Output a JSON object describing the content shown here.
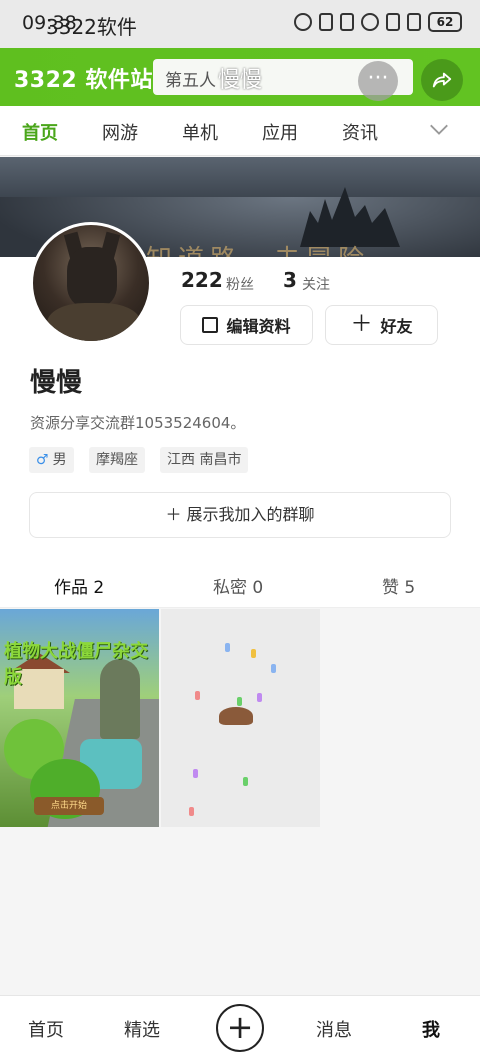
{
  "status_bar": {
    "time": "09:38",
    "app_name": "3322软件",
    "battery": "62"
  },
  "header": {
    "logo": "3322 软件站",
    "search_placeholder": "第五人",
    "page_title": "慢慢",
    "more_label": "···"
  },
  "nav_tabs": [
    {
      "label": "首页",
      "active": true
    },
    {
      "label": "网游",
      "active": false
    },
    {
      "label": "单机",
      "active": false
    },
    {
      "label": "应用",
      "active": false
    },
    {
      "label": "资讯",
      "active": false
    }
  ],
  "banner": {
    "text": "知道路，去冒险"
  },
  "profile": {
    "fans_count": "222",
    "fans_label": "粉丝",
    "follow_count": "3",
    "follow_label": "关注",
    "edit_button": "编辑资料",
    "friend_button": "好友",
    "name": "慢慢",
    "bio": "资源分享交流群1053524604。",
    "tags": [
      {
        "label": "男",
        "icon": "male-icon"
      },
      {
        "label": "摩羯座"
      },
      {
        "label": "江西 南昌市"
      }
    ],
    "groups_button": "＋ 展示我加入的群聊"
  },
  "content_tabs": [
    {
      "label": "作品 2",
      "active": true
    },
    {
      "label": "私密 0",
      "active": false
    },
    {
      "label": "赞 5",
      "active": false
    }
  ],
  "works": [
    {
      "title": "植物大战僵尸杂交版",
      "button": "点击开始"
    },
    {
      "title": ""
    }
  ],
  "bottom_nav": [
    {
      "label": "首页",
      "active": false
    },
    {
      "label": "精选",
      "active": false
    },
    {
      "label": "+",
      "active": false
    },
    {
      "label": "消息",
      "active": false
    },
    {
      "label": "我",
      "active": true
    }
  ],
  "colors": {
    "brand_green": "#5fbf1f",
    "active_tab": "#4aa61a"
  }
}
